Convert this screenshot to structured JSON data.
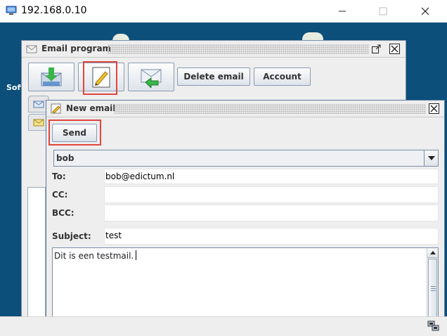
{
  "window": {
    "title": "192.168.0.10"
  },
  "desktop": {
    "label": "Soft"
  },
  "email_program": {
    "title": "Email program",
    "toolbar": {
      "receive_icon": "download-mail-icon",
      "compose_icon": "pencil-note-icon",
      "reply_icon": "reply-envelope-icon",
      "delete_label": "Delete email",
      "account_label": "Account"
    }
  },
  "new_email": {
    "title": "New email",
    "send_label": "Send",
    "account_selected": "bob",
    "to_label": "To:",
    "to_value": "bob@edictum.nl",
    "cc_label": "CC:",
    "cc_value": "",
    "bcc_label": "BCC:",
    "bcc_value": "",
    "subject_label": "Subject:",
    "subject_value": "test",
    "body": "Dit is een testmail."
  },
  "colors": {
    "desktop": "#0c4f7a",
    "highlight": "#e0463e",
    "frame_border": "#7a8ea8"
  }
}
